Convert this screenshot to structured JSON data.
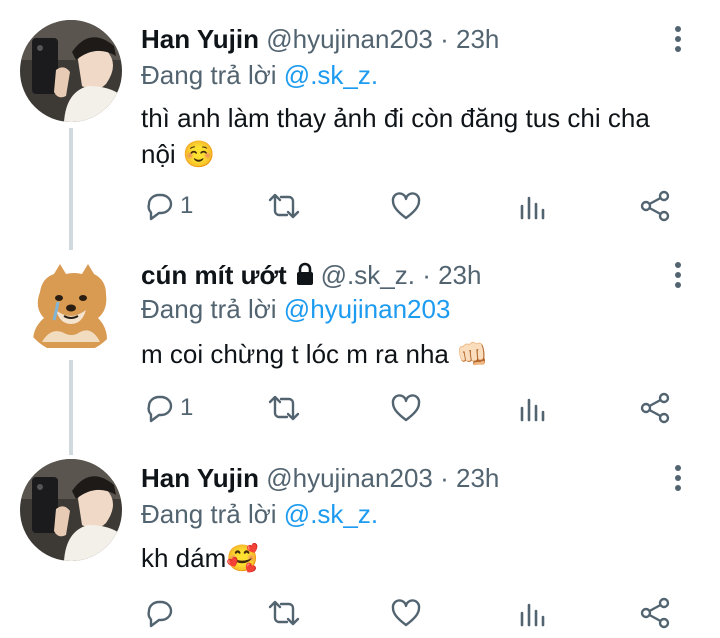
{
  "thread": [
    {
      "name": "Han Yujin",
      "handle": "@hyujinan203",
      "separator": "·",
      "time": "23h",
      "locked": false,
      "reply_prefix": "Đang trả lời",
      "reply_to": "@.sk_z.",
      "text_line1": "thì anh làm thay ảnh đi còn đăng tus chi cha",
      "text_line2": "nội ☺️",
      "reply_count": "1",
      "avatar": "person-avatar"
    },
    {
      "name": "cún mít ướt",
      "handle": "@.sk_z.",
      "separator": "·",
      "time": "23h",
      "locked": true,
      "reply_prefix": "Đang trả lời",
      "reply_to": "@hyujinan203",
      "text_line1": "m coi chừng t lóc m ra nha 👊🏻",
      "text_line2": "",
      "reply_count": "1",
      "avatar": "dog-avatar"
    },
    {
      "name": "Han Yujin",
      "handle": "@hyujinan203",
      "separator": "·",
      "time": "23h",
      "locked": false,
      "reply_prefix": "Đang trả lời",
      "reply_to": "@.sk_z.",
      "text_line1": "kh dám🥰",
      "text_line2": "",
      "reply_count": "",
      "avatar": "person-avatar"
    }
  ],
  "icons": {
    "reply": "reply-icon",
    "retweet": "retweet-icon",
    "like": "like-icon",
    "analytics": "analytics-icon",
    "share": "share-icon",
    "menu": "more-icon",
    "lock": "lock-icon"
  },
  "colors": {
    "text": "#0f1419",
    "muted": "#536471",
    "mention": "#1d9bf0",
    "thread_line": "#cfd9de",
    "icon": "#536471"
  }
}
